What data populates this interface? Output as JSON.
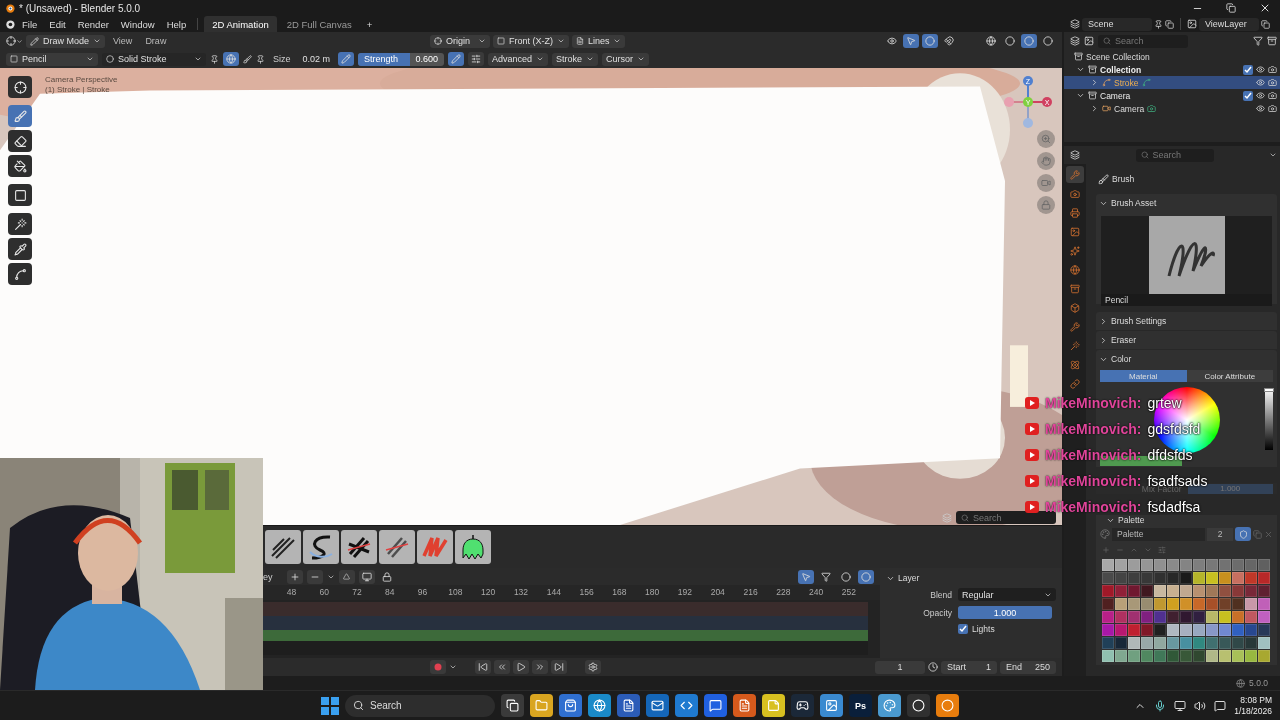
{
  "window": {
    "title": "* (Unsaved) - Blender 5.0.0"
  },
  "menu": [
    "File",
    "Edit",
    "Render",
    "Window",
    "Help"
  ],
  "workspaces": [
    {
      "label": "2D Animation",
      "selected": true
    },
    {
      "label": "2D Full Canvas",
      "selected": false
    }
  ],
  "add_workspace": "+",
  "scene": "Scene",
  "view_layer": "ViewLayer",
  "viewport": {
    "mode": "Draw Mode",
    "menus": [
      "View",
      "Draw"
    ],
    "pivot": "Origin",
    "view": "Front (X-Z)",
    "placement": "Lines",
    "tool": "Pencil",
    "stroke_type": "Solid Stroke",
    "size_label": "Size",
    "size": "0.02 m",
    "strength_label": "Strength",
    "strength": "0.600",
    "strength_level": {
      "level": 0.6
    },
    "dropdowns": [
      "Advanced",
      "Stroke",
      "Cursor"
    ],
    "overlay_lines": [
      "Camera Perspective",
      "(1) Stroke | Stroke"
    ],
    "gizmo": [
      "Z",
      "Y",
      "X"
    ],
    "tools": [
      {
        "kind": "cursor",
        "selected": false
      },
      {
        "kind": "draw",
        "selected": true
      },
      {
        "kind": "erase",
        "selected": false
      },
      {
        "kind": "fill",
        "selected": false
      },
      {
        "kind": "box",
        "selected": false
      },
      {
        "kind": "pick",
        "selected": false
      },
      {
        "kind": "sample",
        "selected": false
      },
      {
        "kind": "curve",
        "selected": false
      }
    ]
  },
  "asset_shelf": {
    "search": "Search",
    "brushes": [
      {
        "kind": "hatch"
      },
      {
        "kind": "ink"
      },
      {
        "kind": "cross"
      },
      {
        "kind": "cross-soft"
      },
      {
        "kind": "scribble"
      },
      {
        "kind": "blob"
      }
    ]
  },
  "timeline": {
    "header_cut": "ey",
    "frames": [
      "48",
      "60",
      "72",
      "84",
      "96",
      "108",
      "120",
      "132",
      "144",
      "156",
      "168",
      "180",
      "192",
      "204",
      "216",
      "228",
      "240",
      "252"
    ],
    "layer": {
      "title": "Layer",
      "blend_label": "Blend",
      "blend": "Regular",
      "opacity_label": "Opacity",
      "opacity": "1.000",
      "opacity_level": {
        "level": 1
      },
      "lights_label": "Lights",
      "lights_checked": true
    },
    "current_frame": "1",
    "start_label": "Start",
    "start": "1",
    "end_label": "End",
    "end": "250"
  },
  "outliner": {
    "search": "Search",
    "root": "Scene Collection",
    "items": [
      {
        "label": "Collection",
        "kind": "collection",
        "expanded": true,
        "checked": true,
        "selected": false,
        "children": [
          {
            "label": "Stroke",
            "kind": "stroke",
            "expanded": false,
            "selected": true
          }
        ]
      },
      {
        "label": "Camera",
        "kind": "collection",
        "expanded": true,
        "checked": true,
        "selected": false,
        "children": [
          {
            "label": "Camera",
            "kind": "camera",
            "expanded": false,
            "selected": false
          }
        ]
      }
    ]
  },
  "properties": {
    "search": "Search",
    "context": "Brush",
    "tabs": [
      {
        "kind": "tool",
        "selected": true
      },
      {
        "kind": "render",
        "selected": false
      },
      {
        "kind": "output",
        "selected": false
      },
      {
        "kind": "view-layer",
        "selected": false
      },
      {
        "kind": "scene",
        "selected": false
      },
      {
        "kind": "world",
        "selected": false
      },
      {
        "kind": "collection",
        "selected": false
      },
      {
        "kind": "object",
        "selected": false
      },
      {
        "kind": "modifier",
        "selected": false
      },
      {
        "kind": "effect",
        "selected": false
      },
      {
        "kind": "physics",
        "selected": false
      },
      {
        "kind": "data",
        "selected": false
      }
    ],
    "brush_asset": {
      "title": "Brush Asset",
      "expanded": true,
      "name": "Pencil"
    },
    "brush_settings": {
      "title": "Brush Settings",
      "expanded": false
    },
    "eraser": {
      "title": "Eraser",
      "expanded": false
    },
    "color": {
      "title": "Color",
      "expanded": true,
      "modes": [
        {
          "label": "Material",
          "selected": true
        },
        {
          "label": "Color Attribute",
          "selected": false
        }
      ],
      "value_slider": {
        "level": 1
      },
      "mix_label": "Mix Factor",
      "mix_value": "1.000",
      "mix_disabled": true
    },
    "palette": {
      "title": "Palette",
      "expanded": true,
      "name": "Palette",
      "users": "2",
      "fake_user": true,
      "swatches": [
        {
          "color": "#a8a8a8"
        },
        {
          "color": "#a2a2a2"
        },
        {
          "color": "#9c9c9c"
        },
        {
          "color": "#969696"
        },
        {
          "color": "#909090"
        },
        {
          "color": "#8a8a8a"
        },
        {
          "color": "#848484"
        },
        {
          "color": "#7e7e7e"
        },
        {
          "color": "#787878"
        },
        {
          "color": "#727272"
        },
        {
          "color": "#6c6c6c"
        },
        {
          "color": "#666666"
        },
        {
          "color": "#606060"
        },
        {
          "color": "#4a4a4a"
        },
        {
          "color": "#444444"
        },
        {
          "color": "#3e3e3e"
        },
        {
          "color": "#383838"
        },
        {
          "color": "#303030"
        },
        {
          "color": "#282828"
        },
        {
          "color": "#1a1a1a"
        },
        {
          "color": "#b5b52a"
        },
        {
          "color": "#c8c020"
        },
        {
          "color": "#c8901e"
        },
        {
          "color": "#c87060"
        },
        {
          "color": "#c03828"
        },
        {
          "color": "#b82828"
        },
        {
          "color": "#a01828"
        },
        {
          "color": "#902038"
        },
        {
          "color": "#701830"
        },
        {
          "color": "#401820"
        },
        {
          "color": "#c8b8a0"
        },
        {
          "color": "#c8b090"
        },
        {
          "color": "#c0a890"
        },
        {
          "color": "#b89070"
        },
        {
          "color": "#a07858"
        },
        {
          "color": "#905040"
        },
        {
          "color": "#883838"
        },
        {
          "color": "#782838"
        },
        {
          "color": "#602030"
        },
        {
          "color": "#502020"
        },
        {
          "color": "#b8a078"
        },
        {
          "color": "#a89878"
        },
        {
          "color": "#988c70"
        },
        {
          "color": "#c09830"
        },
        {
          "color": "#d0a020"
        },
        {
          "color": "#d09028"
        },
        {
          "color": "#c86828"
        },
        {
          "color": "#a85028"
        },
        {
          "color": "#704028"
        },
        {
          "color": "#503020"
        },
        {
          "color": "#c898a8"
        },
        {
          "color": "#c060b8"
        },
        {
          "color": "#b82088"
        },
        {
          "color": "#b03060"
        },
        {
          "color": "#a03070"
        },
        {
          "color": "#802080"
        },
        {
          "color": "#503090"
        },
        {
          "color": "#402030"
        },
        {
          "color": "#301830"
        },
        {
          "color": "#302040"
        },
        {
          "color": "#b8b868"
        },
        {
          "color": "#c8c020"
        },
        {
          "color": "#c87028"
        },
        {
          "color": "#c05860"
        },
        {
          "color": "#c060c0"
        },
        {
          "color": "#a818a8"
        },
        {
          "color": "#b81870"
        },
        {
          "color": "#c02030"
        },
        {
          "color": "#801828"
        },
        {
          "color": "#202020"
        },
        {
          "color": "#b0b8c0"
        },
        {
          "color": "#a8b0c0"
        },
        {
          "color": "#98a8c0"
        },
        {
          "color": "#8898c8"
        },
        {
          "color": "#7088d0"
        },
        {
          "color": "#3060c0"
        },
        {
          "color": "#284890"
        },
        {
          "color": "#283858"
        },
        {
          "color": "#204058"
        },
        {
          "color": "#182838"
        },
        {
          "color": "#b0b8b8"
        },
        {
          "color": "#98a8a8"
        },
        {
          "color": "#90a8a0"
        },
        {
          "color": "#6898a0"
        },
        {
          "color": "#4890a0"
        },
        {
          "color": "#308880"
        },
        {
          "color": "#407070"
        },
        {
          "color": "#385858"
        },
        {
          "color": "#304848"
        },
        {
          "color": "#283838"
        },
        {
          "color": "#a0c0c0"
        },
        {
          "color": "#90c0b0"
        },
        {
          "color": "#80a890"
        },
        {
          "color": "#70a080"
        },
        {
          "color": "#508860"
        },
        {
          "color": "#407858"
        },
        {
          "color": "#305838"
        },
        {
          "color": "#385838"
        },
        {
          "color": "#304830"
        },
        {
          "color": "#b0b888"
        },
        {
          "color": "#b8c070"
        },
        {
          "color": "#a8c058"
        },
        {
          "color": "#98b840"
        },
        {
          "color": "#a8a830"
        }
      ]
    }
  },
  "chat": [
    {
      "user": "MikeMinovich:",
      "message": "grtew"
    },
    {
      "user": "MikeMinovich:",
      "message": "gdsfdsfd"
    },
    {
      "user": "MikeMinovich:",
      "message": "dfdsfds"
    },
    {
      "user": "MikeMinovich:",
      "message": "fsadfsads"
    },
    {
      "user": "MikeMinovich:",
      "message": "fsdadfsa"
    }
  ],
  "webcam": {
    "kind": "picture"
  },
  "status_bar": {
    "version": "5.0.0"
  },
  "taskbar": {
    "search": "Search",
    "apps": [
      {
        "kind": "files"
      },
      {
        "kind": "folder"
      },
      {
        "kind": "store"
      },
      {
        "kind": "browser"
      },
      {
        "kind": "word"
      },
      {
        "kind": "mail"
      },
      {
        "kind": "code"
      },
      {
        "kind": "chat"
      },
      {
        "kind": "office"
      },
      {
        "kind": "notes"
      },
      {
        "kind": "steam"
      },
      {
        "kind": "photos"
      },
      {
        "kind": "photoshop",
        "label": "Ps"
      },
      {
        "kind": "paint"
      },
      {
        "kind": "obs"
      },
      {
        "kind": "blender"
      }
    ],
    "time": "8:08 PM",
    "date": "1/18/2026"
  }
}
